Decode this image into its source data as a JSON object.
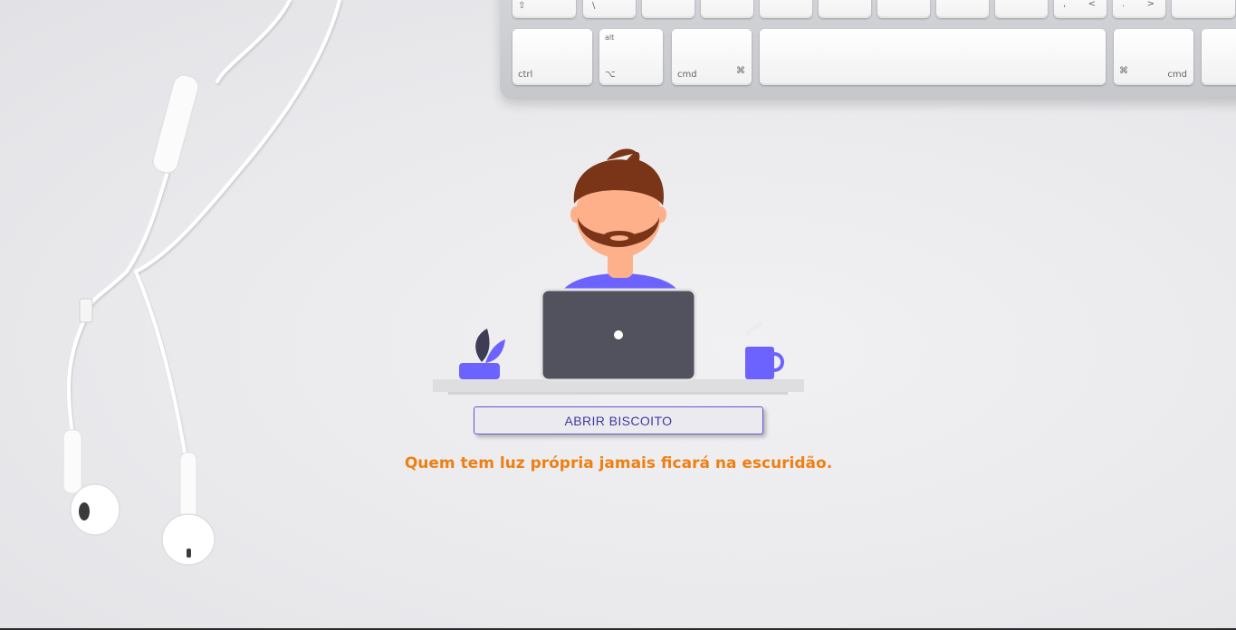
{
  "button": {
    "label": "ABRIR BISCOITO"
  },
  "message": {
    "text": "Quem tem luz própria jamais ficará na escuridão."
  },
  "keyboard": {
    "keys": {
      "ctrl": "ctrl",
      "alt": "alt",
      "option_symbol": "⌥",
      "cmd_left": "cmd",
      "cmd_symbol_left": "⌘",
      "cmd_right": "cmd",
      "cmd_symbol_right": "⌘",
      "shift_symbol": "⇧",
      "backslash": "\\",
      "comma": ",",
      "less_than": "<",
      "period": ".",
      "greater_than": ">"
    }
  },
  "colors": {
    "accent": "#6c63ff",
    "quote": "#ef7f13",
    "laptop": "#52525f",
    "hair": "#7a3518",
    "skin": "#fdb08a"
  },
  "icons": {
    "illustration": "man-at-laptop-illustration",
    "plant": "plant-icon",
    "mug": "coffee-mug-icon"
  }
}
